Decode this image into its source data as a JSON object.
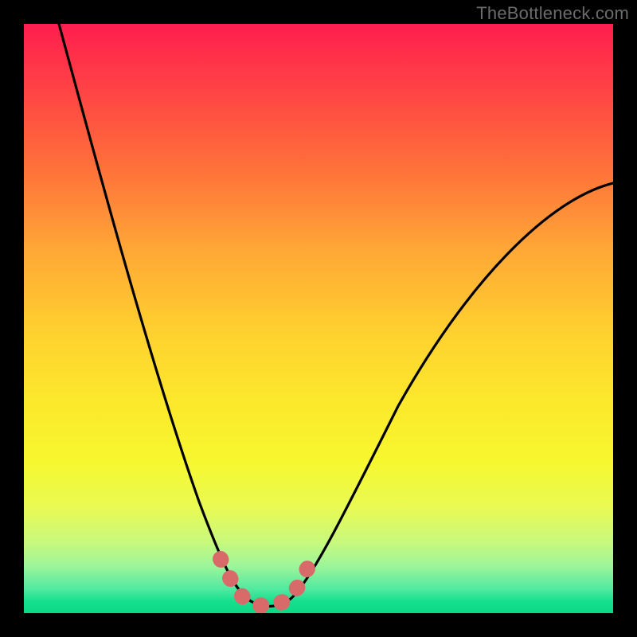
{
  "watermark": "TheBottleneck.com",
  "chart_data": {
    "type": "line",
    "title": "",
    "xlabel": "",
    "ylabel": "",
    "xlim": [
      0,
      100
    ],
    "ylim": [
      0,
      100
    ],
    "grid": false,
    "series": [
      {
        "name": "bottleneck-curve",
        "x": [
          6,
          10,
          14,
          18,
          22,
          26,
          30,
          32,
          34,
          36,
          38,
          40,
          42,
          44,
          46,
          48,
          52,
          58,
          66,
          76,
          88,
          100
        ],
        "values": [
          100,
          87,
          74,
          62,
          50,
          38,
          26,
          20,
          14,
          9,
          5,
          3,
          2,
          2,
          3,
          6,
          12,
          22,
          35,
          49,
          62,
          73
        ]
      },
      {
        "name": "valley-marker",
        "x": [
          34,
          36,
          38,
          40,
          42,
          44,
          46
        ],
        "values": [
          9,
          5,
          3,
          2,
          2,
          3,
          6
        ]
      }
    ],
    "gradient_stops": [
      {
        "pos": 0,
        "color": "#ff1e4e"
      },
      {
        "pos": 10,
        "color": "#ff3f46"
      },
      {
        "pos": 24,
        "color": "#ff6f3a"
      },
      {
        "pos": 38,
        "color": "#ffa636"
      },
      {
        "pos": 52,
        "color": "#ffd02f"
      },
      {
        "pos": 64,
        "color": "#fce82c"
      },
      {
        "pos": 74,
        "color": "#f7f72e"
      },
      {
        "pos": 82,
        "color": "#e9fa53"
      },
      {
        "pos": 88,
        "color": "#c7f97d"
      },
      {
        "pos": 92,
        "color": "#9df59a"
      },
      {
        "pos": 96,
        "color": "#4fe9a0"
      },
      {
        "pos": 98,
        "color": "#15e08e"
      },
      {
        "pos": 100,
        "color": "#0bd985"
      }
    ],
    "annotations": []
  }
}
